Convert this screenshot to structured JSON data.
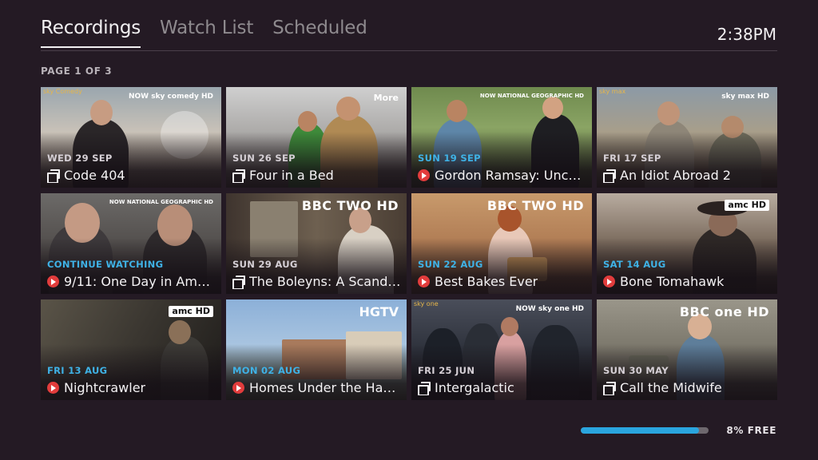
{
  "tabs": [
    {
      "label": "Recordings",
      "active": true
    },
    {
      "label": "Watch List",
      "active": false
    },
    {
      "label": "Scheduled",
      "active": false
    }
  ],
  "clock": "2:38PM",
  "page_label": "PAGE 1 OF 3",
  "cards": [
    {
      "date": "WED 29 SEP",
      "title": "Code 404",
      "icon": "series-icon",
      "channel_logo": "NOW sky comedy HD",
      "corner": "sky Comedy"
    },
    {
      "date": "SUN 26 SEP",
      "title": "Four in a Bed",
      "icon": "series-icon",
      "channel_logo": "More"
    },
    {
      "date": "SUN 19 SEP",
      "title": "Gordon Ramsay: Unch…",
      "icon": "record-icon",
      "channel_logo": "NOW NATIONAL GEOGRAPHIC HD"
    },
    {
      "date": "FRI 17 SEP",
      "title": "An Idiot Abroad 2",
      "icon": "series-icon",
      "channel_logo": "sky max HD",
      "corner": "sky max"
    },
    {
      "date": "CONTINUE WATCHING",
      "title": "9/11: One Day in Ame…",
      "icon": "record-icon",
      "channel_logo": "NOW NATIONAL GEOGRAPHIC HD"
    },
    {
      "date": "SUN 29 AUG",
      "title": "The Boleyns: A Scand…",
      "icon": "series-icon",
      "channel_logo": "BBC TWO HD"
    },
    {
      "date": "SUN 22 AUG",
      "title": "Best Bakes Ever",
      "icon": "record-icon",
      "channel_logo": "BBC TWO HD"
    },
    {
      "date": "SAT 14 AUG",
      "title": "Bone Tomahawk",
      "icon": "record-icon",
      "channel_logo": "amc HD"
    },
    {
      "date": "FRI 13 AUG",
      "title": "Nightcrawler",
      "icon": "record-icon",
      "channel_logo": "amc HD"
    },
    {
      "date": "MON 02 AUG",
      "title": "Homes Under the Ha…",
      "icon": "record-icon",
      "channel_logo": "HGTV"
    },
    {
      "date": "FRI 25 JUN",
      "title": "Intergalactic",
      "icon": "series-icon",
      "channel_logo": "NOW sky one HD",
      "corner": "sky one"
    },
    {
      "date": "SUN 30 MAY",
      "title": "Call the Midwife",
      "icon": "series-icon",
      "channel_logo": "BBC one HD"
    }
  ],
  "storage": {
    "label": "8% FREE",
    "used_fraction": 0.92
  },
  "colors": {
    "accent": "#3fb2e6",
    "record": "#e23c3c",
    "background": "#241a24"
  }
}
